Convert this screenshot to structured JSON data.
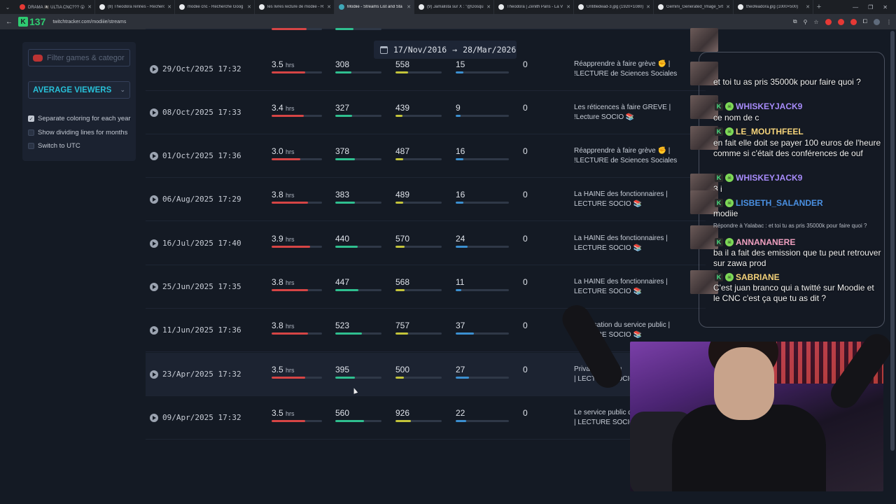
{
  "browser": {
    "tabs": [
      {
        "label": "DRAMA 🏴‍☠️ ULTIA CNC??? 😮",
        "color": "#e53935",
        "active": false
      },
      {
        "label": "(8) Theodora rennes - Recherc",
        "color": "#e8eaed",
        "active": false
      },
      {
        "label": "modiie cnc - Recherche Goog",
        "color": "#e8eaed",
        "active": false
      },
      {
        "label": "les livres lecture de modiie - R",
        "color": "#e8eaed",
        "active": false
      },
      {
        "label": "Modiie - Streams List and Sta",
        "color": "#3fa7b8",
        "active": true
      },
      {
        "label": "(9) Jamalista sur X : \"@Dosqu",
        "color": "#e8eaed",
        "active": false
      },
      {
        "label": "Theodora | Zénith Paris - La V",
        "color": "#e8eaed",
        "active": false
      },
      {
        "label": "Untitledead-3.jpg (1920×1080)",
        "color": "#e8eaed",
        "active": false
      },
      {
        "label": "Gemini_Generated_Image_5rt",
        "color": "#e8eaed",
        "active": false
      },
      {
        "label": "theofeadora.jpg (1000×500)",
        "color": "#e8eaed",
        "active": false
      }
    ],
    "new_tab": "+",
    "url": "twitchtracker.com/modiiie/streams",
    "logo_text": "137"
  },
  "sidebar": {
    "filter_placeholder": "Filter games & categor",
    "metric_select": "AVERAGE VIEWERS",
    "options": [
      {
        "label": "Separate coloring for each year",
        "checked": true
      },
      {
        "label": "Show dividing lines for months",
        "checked": false
      },
      {
        "label": "Switch to UTC",
        "checked": false
      }
    ]
  },
  "date_range": {
    "from": "17/Nov/2016",
    "arrow": "→",
    "to": "28/Mar/2026"
  },
  "streams": [
    {
      "date": "29/Oct/2025 17:32",
      "hours": "3.5",
      "unit": "hrs",
      "avg": "308",
      "peak": "558",
      "followers": "15",
      "views": "0",
      "title": [
        "Réapprendre à faire grève ✊ |",
        "!LECTURE de Sciences Sociales"
      ],
      "bars": [
        0.66,
        0.35,
        0.28,
        0.14
      ]
    },
    {
      "date": "08/Oct/2025 17:33",
      "hours": "3.4",
      "unit": "hrs",
      "avg": "327",
      "peak": "439",
      "followers": "9",
      "views": "0",
      "title": [
        "Les réticences à faire GREVE |",
        "!Lecture SOCIO 📚"
      ],
      "bars": [
        0.64,
        0.36,
        0.15,
        0.09
      ]
    },
    {
      "date": "01/Oct/2025 17:36",
      "hours": "3.0",
      "unit": "hrs",
      "avg": "378",
      "peak": "487",
      "followers": "16",
      "views": "0",
      "title": [
        "Réapprendre à faire grève ✊ |",
        "!LECTURE de Sciences Sociales"
      ],
      "bars": [
        0.57,
        0.42,
        0.17,
        0.15
      ]
    },
    {
      "date": "06/Aug/2025 17:29",
      "hours": "3.8",
      "unit": "hrs",
      "avg": "383",
      "peak": "489",
      "followers": "16",
      "views": "0",
      "title": [
        "La HAINE des fonctionnaires |",
        "LECTURE SOCIO 📚"
      ],
      "bars": [
        0.72,
        0.43,
        0.17,
        0.15
      ]
    },
    {
      "date": "16/Jul/2025 17:40",
      "hours": "3.9",
      "unit": "hrs",
      "avg": "440",
      "peak": "570",
      "followers": "24",
      "views": "0",
      "title": [
        "La HAINE des fonctionnaires |",
        "LECTURE SOCIO 📚"
      ],
      "bars": [
        0.77,
        0.49,
        0.2,
        0.22
      ]
    },
    {
      "date": "25/Jun/2025 17:35",
      "hours": "3.8",
      "unit": "hrs",
      "avg": "447",
      "peak": "568",
      "followers": "11",
      "views": "0",
      "title": [
        "La HAINE des fonctionnaires |",
        "LECTURE SOCIO 📚"
      ],
      "bars": [
        0.72,
        0.5,
        0.2,
        0.1
      ]
    },
    {
      "date": "11/Jun/2025 17:36",
      "hours": "3.8",
      "unit": "hrs",
      "avg": "523",
      "peak": "757",
      "followers": "37",
      "views": "0",
      "title": [
        "Privatisation du service public |",
        "LECTURE SOCIO 📚"
      ],
      "bars": [
        0.72,
        0.58,
        0.27,
        0.34
      ]
    },
    {
      "date": "23/Apr/2025 17:32",
      "hours": "3.5",
      "unit": "hrs",
      "avg": "395",
      "peak": "500",
      "followers": "27",
      "views": "0",
      "title": [
        "Privatisation du",
        "| LECTURE SOCIO"
      ],
      "bars": [
        0.66,
        0.42,
        0.18,
        0.25
      ],
      "highlight": true
    },
    {
      "date": "09/Apr/2025 17:32",
      "hours": "3.5",
      "unit": "hrs",
      "avg": "560",
      "peak": "926",
      "followers": "22",
      "views": "0",
      "title": [
        "Le service public d",
        "| LECTURE SOCIO"
      ],
      "bars": [
        0.66,
        0.62,
        0.33,
        0.2
      ]
    }
  ],
  "colors": {
    "hours": "#d64545",
    "avg": "#2fbf8f",
    "peak": "#c3c43a",
    "followers": "#3b8fd0",
    "accent": "#28c0d8"
  },
  "chat": {
    "messages": [
      {
        "type": "text",
        "text": "et toi tu as pris 35000k pour faire quoi ?"
      },
      {
        "type": "user",
        "name": "WHISKEYJACK9",
        "color": "#a78bfa",
        "text": "ce nom de c"
      },
      {
        "type": "user",
        "name": "LE_MOUTHFEEL",
        "color": "#f5d37a",
        "text": "en fait elle doit se payer 100 euros de l'heure comme si c'était des conférences de ouf"
      },
      {
        "type": "user",
        "name": "WHISKEYJACK9",
        "color": "#a78bfa",
        "text": "3 i"
      },
      {
        "type": "user",
        "name": "LISBETH_SALANDER",
        "color": "#4a90e2",
        "text": "modiie"
      },
      {
        "type": "reply",
        "reply": "Répondre à Yalabac : et toi tu as pris 35000k pour faire quoi ?",
        "name": "ANNANANERE",
        "color": "#f0a0c0",
        "text": "ba il a fait des emission que tu peut retrouver sur zawa prod"
      },
      {
        "type": "user",
        "name": "SABRIANE",
        "color": "#f5d37a",
        "text": "C'est juan branco qui a twitté sur Moodie et le CNC c'est ça que tu as dit ?"
      }
    ]
  }
}
